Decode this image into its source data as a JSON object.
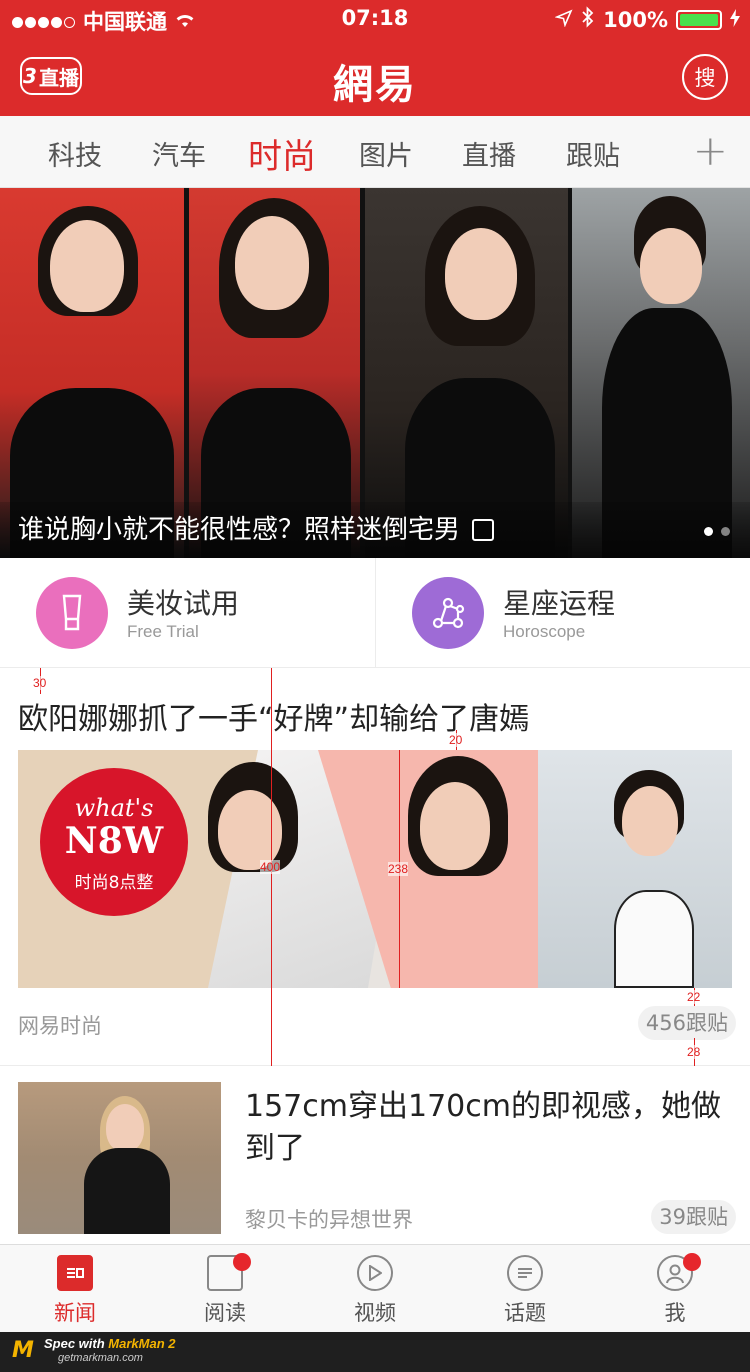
{
  "status_bar": {
    "carrier": "中国联通",
    "time": "07:18",
    "battery": "100%"
  },
  "header": {
    "live_count": "3",
    "live_label": "直播",
    "logo": "網易",
    "search_label": "搜",
    "brand_color": "#dc2b2b"
  },
  "tabs": {
    "items": [
      {
        "label": "科技"
      },
      {
        "label": "汽车"
      },
      {
        "label": "时尚"
      },
      {
        "label": "图片"
      },
      {
        "label": "直播"
      },
      {
        "label": "跟贴"
      }
    ],
    "active": "时尚",
    "add_icon": "plus-icon"
  },
  "banner": {
    "title": "谁说胸小就不能很性感？照样迷倒宅男",
    "icon": "gallery-icon"
  },
  "features": [
    {
      "title": "美妆试用",
      "subtitle": "Free Trial",
      "icon": "cosmetics-icon",
      "color": "#ea6fbd"
    },
    {
      "title": "星座运程",
      "subtitle": "Horoscope",
      "icon": "constellation-icon",
      "color": "#9e6bd6"
    }
  ],
  "article1": {
    "title": "欧阳娜娜抓了一手“好牌”却输给了唐嫣",
    "badge_line1": "what's",
    "badge_line2": "N8W",
    "badge_line3": "时尚8点整",
    "source": "网易时尚",
    "replies": "456跟贴"
  },
  "spec": {
    "top": "30",
    "gap_title_image": "20",
    "row_height": "400",
    "image_height": "238",
    "gap_image_source": "22",
    "gap_source_bottom": "28"
  },
  "article2": {
    "title": "157cm穿出170cm的即视感，她做到了",
    "source": "黎贝卡的异想世界",
    "replies": "39跟贴"
  },
  "tabbar": {
    "items": [
      {
        "label": "新闻",
        "icon": "news-icon"
      },
      {
        "label": "阅读",
        "icon": "book-icon"
      },
      {
        "label": "视频",
        "icon": "play-icon"
      },
      {
        "label": "话题",
        "icon": "chat-icon"
      },
      {
        "label": "我",
        "icon": "profile-icon"
      }
    ],
    "active": "新闻"
  },
  "footer": {
    "spec_prefix": "Spec with ",
    "spec_brand": "MarkMan 2",
    "url": "getmarkman.com"
  }
}
